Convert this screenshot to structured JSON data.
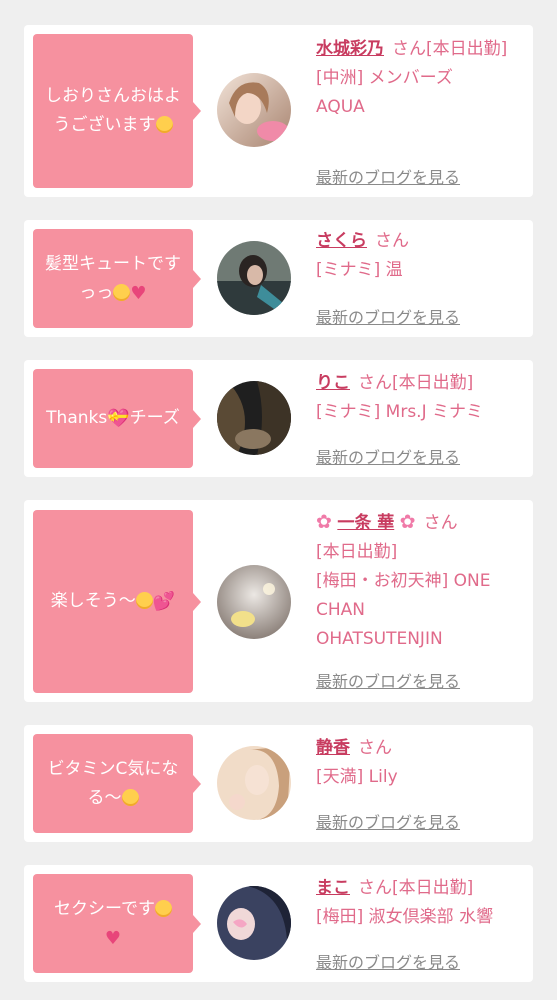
{
  "posts": [
    {
      "message": "しおりさんおはようございます",
      "emoji": [
        "smiling-face"
      ],
      "name": "水城彩乃",
      "suffix": "さん",
      "detail": "[本日出勤]\n[中洲] メンバーズAQUA",
      "blog_link": "最新のブログを見る",
      "avatar_colors": [
        "#e8d4c7",
        "#b89b88"
      ]
    },
    {
      "message": "髪型キュートですっっ",
      "emoji": [
        "laughing-face",
        "heart"
      ],
      "name": "さくら",
      "suffix": "さん",
      "detail": "[ミナミ] 温",
      "blog_link": "最新のブログを見る",
      "avatar_colors": [
        "#3c3c3c",
        "#6a8a8f"
      ]
    },
    {
      "message": "Thanks チーズ",
      "emoji": [
        "heart-with-ribbon"
      ],
      "name": "りこ",
      "suffix": "さん[本日出勤]",
      "detail": "[ミナミ] Mrs.J ミナミ",
      "blog_link": "最新のブログを見る",
      "avatar_colors": [
        "#2a2a2a",
        "#6b5a43"
      ]
    },
    {
      "message": "楽しそう〜",
      "emoji": [
        "smiling-face",
        "two-hearts"
      ],
      "name": "一条 華",
      "suffix": "さん",
      "detail": "[本日出勤]\n[梅田・お初天神] ONE CHAN OHATSUTENJIN",
      "blog_link": "最新のブログを見る",
      "avatar_colors": [
        "#d8d4d2",
        "#9a8f87"
      ]
    },
    {
      "message": "ビタミンC気になる〜",
      "emoji": [
        "heart-eyes-face"
      ],
      "name": "静香",
      "suffix": "さん",
      "detail": "[天満] Lily",
      "blog_link": "最新のブログを見る",
      "avatar_colors": [
        "#efd9c4",
        "#c9a88c"
      ]
    },
    {
      "message": "セクシーです",
      "emoji": [
        "smiling-face",
        "heart"
      ],
      "name": "まこ",
      "suffix": "さん[本日出勤]",
      "detail": "[梅田] 淑女倶楽部 水響",
      "blog_link": "最新のブログを見る",
      "avatar_colors": [
        "#2e3550",
        "#7a88b0"
      ]
    }
  ]
}
